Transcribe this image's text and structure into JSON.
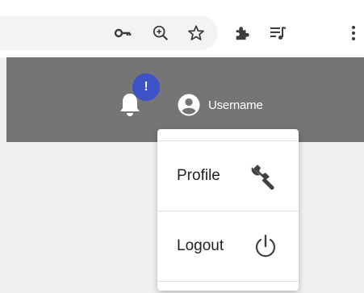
{
  "browser_toolbar": {
    "icons": [
      "key-icon",
      "zoom-icon",
      "star-icon",
      "extensions-icon",
      "media-queue-icon",
      "more-icon"
    ]
  },
  "header": {
    "background": "#757575",
    "notifications": {
      "icon": "bell-icon",
      "badge_text": "!",
      "badge_color": "#3d52c7"
    },
    "user": {
      "icon": "account-circle-icon",
      "name": "Username"
    }
  },
  "menu": {
    "items": [
      {
        "label": "Profile",
        "icon": "wrench-icon"
      },
      {
        "label": "Logout",
        "icon": "power-icon"
      }
    ]
  }
}
